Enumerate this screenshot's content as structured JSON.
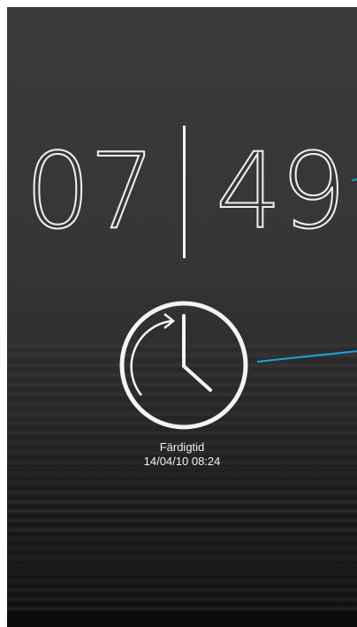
{
  "clock": {
    "hours": "07",
    "minutes": "49"
  },
  "finish": {
    "label": "Färdigtid",
    "datetime": "14/04/10 08:24"
  },
  "colors": {
    "callout": "#1aa3e0",
    "foreground": "#f2f2f2"
  },
  "icons": {
    "timer": "clock-with-refresh-arrow"
  }
}
